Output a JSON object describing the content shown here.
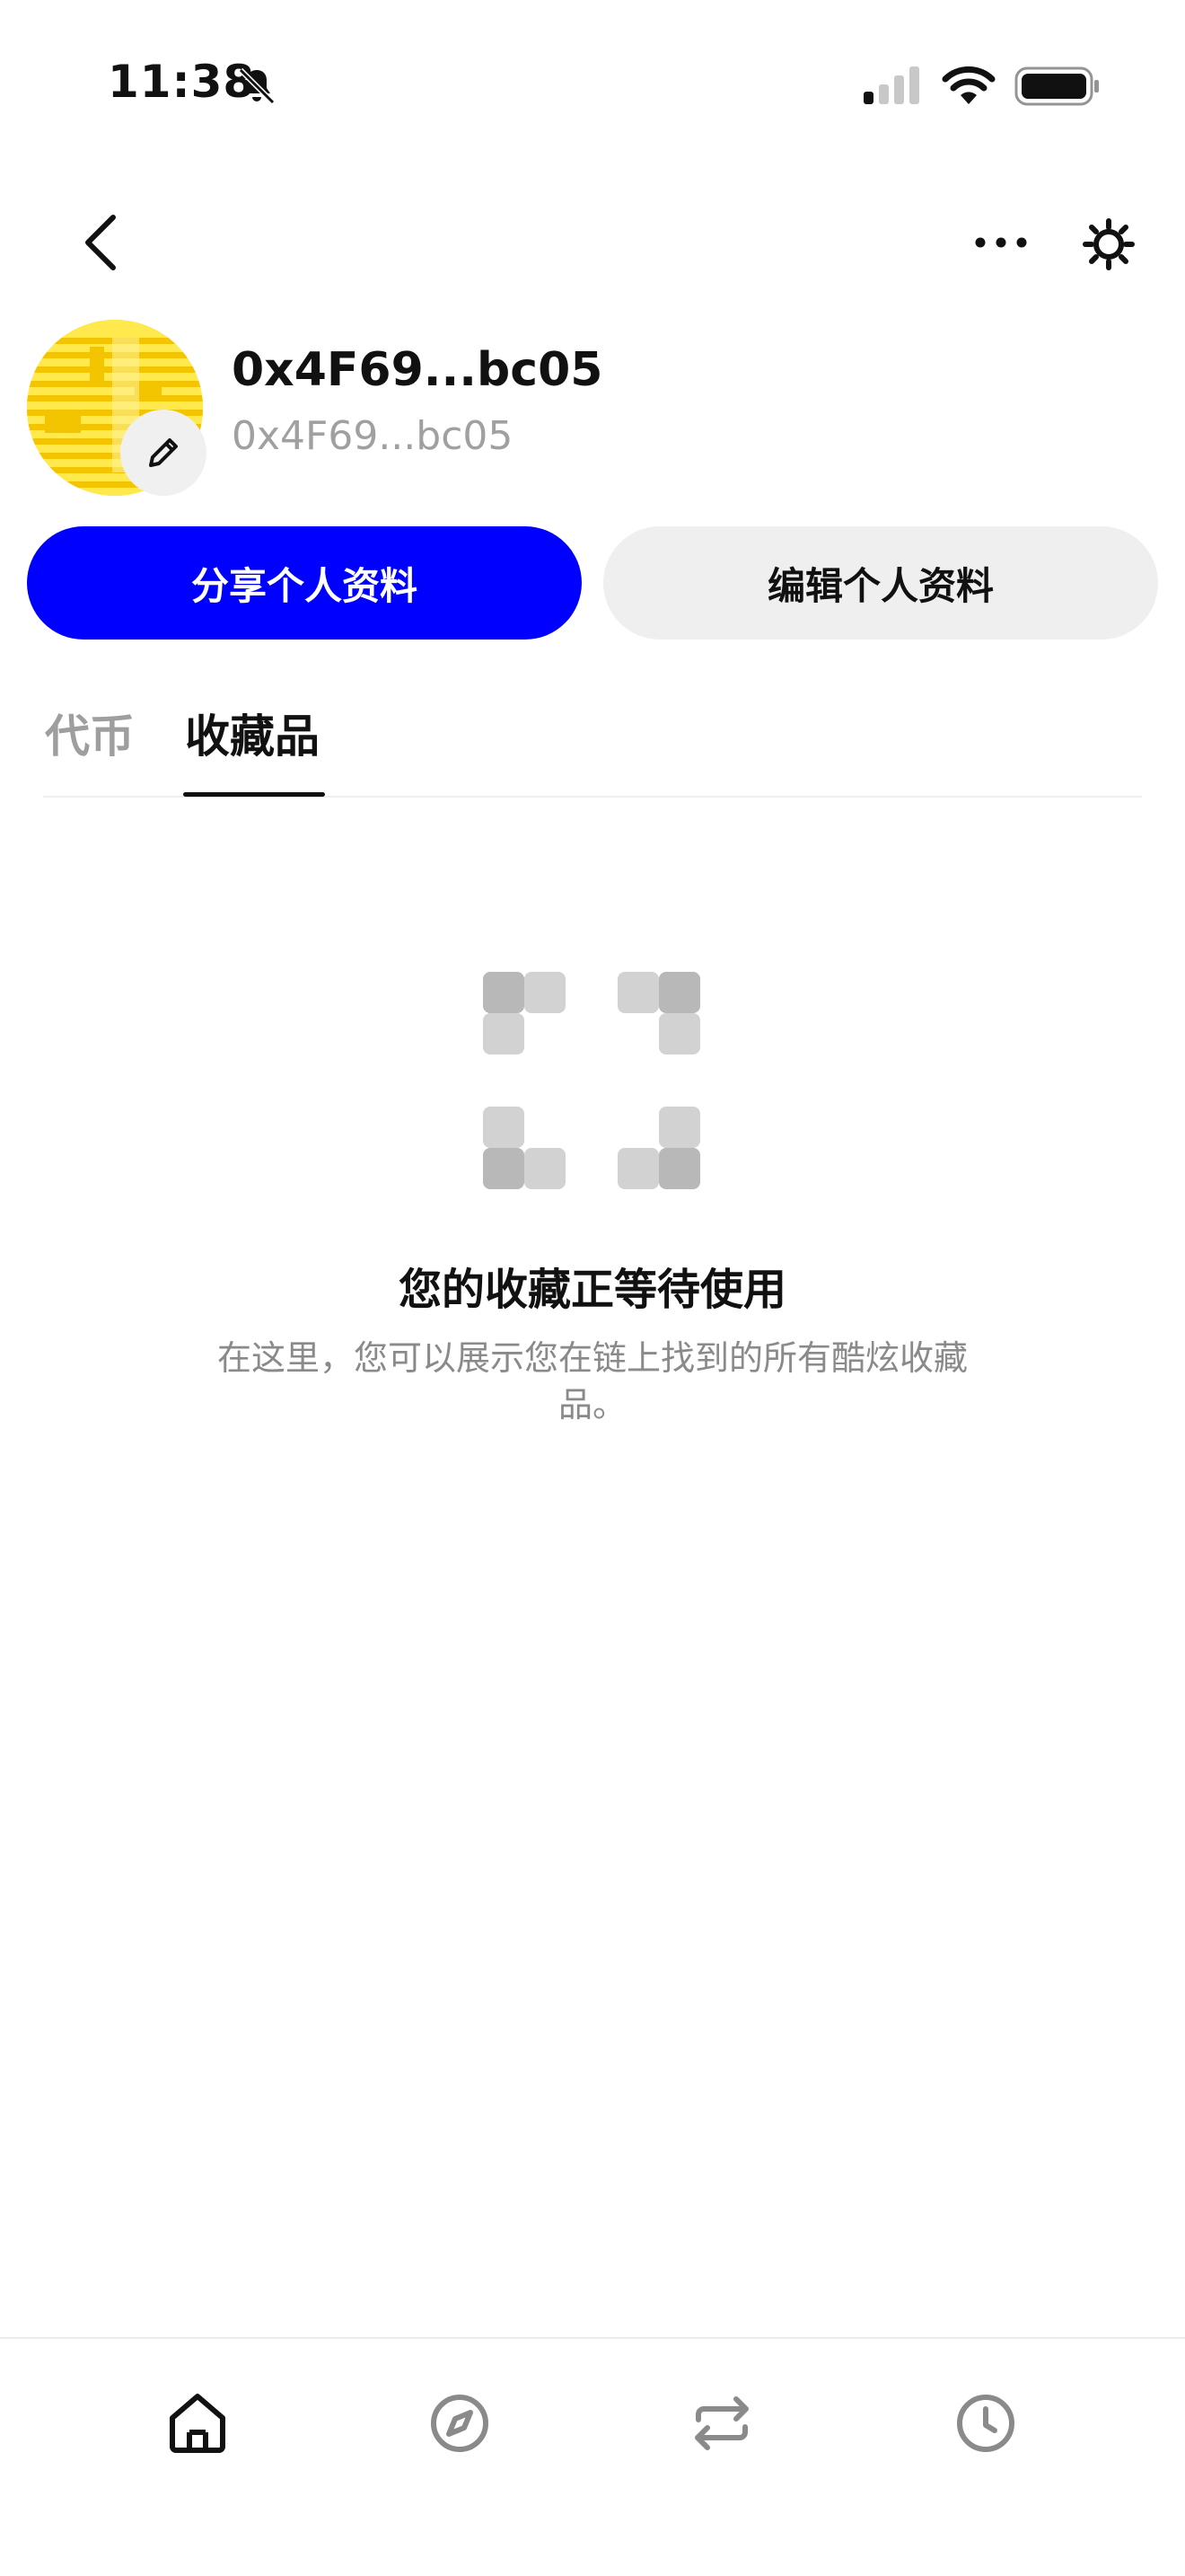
{
  "status_bar": {
    "time": "11:38"
  },
  "profile": {
    "name": "0x4F69...bc05",
    "address": "0x4F69...bc05"
  },
  "actions": {
    "share_label": "分享个人资料",
    "edit_label": "编辑个人资料"
  },
  "tabs": [
    {
      "label": "代币",
      "active": false
    },
    {
      "label": "收藏品",
      "active": true
    }
  ],
  "empty_state": {
    "title": "您的收藏正等待使用",
    "description": "在这里，您可以展示您在链上找到的所有酷炫收藏品。"
  },
  "bottom_nav": [
    {
      "icon": "home-icon",
      "active": true
    },
    {
      "icon": "explore-icon",
      "active": false
    },
    {
      "icon": "swap-icon",
      "active": false
    },
    {
      "icon": "history-icon",
      "active": false
    }
  ],
  "colors": {
    "accent": "#0000ff",
    "avatar": "#ffe94d",
    "muted_text": "#9e9e9e"
  }
}
